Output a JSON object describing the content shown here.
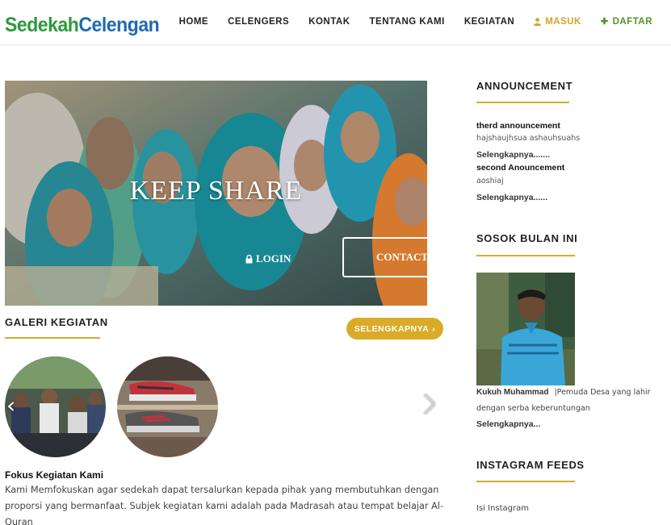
{
  "logo": {
    "part1": "Sedekah",
    "part2": "Celengan"
  },
  "nav": {
    "items": [
      "HOME",
      "CELENGERS",
      "KONTAK",
      "TENTANG KAMI",
      "KEGIATAN"
    ],
    "masuk": "MASUK",
    "daftar": "DAFTAR",
    "masuk_icon": "user-icon",
    "daftar_icon": "plus-icon"
  },
  "hero": {
    "title": "KEEP SHARE",
    "login_label": "LOGIN",
    "contact_label": "CONTACT"
  },
  "galeri": {
    "title": "GALERI KEGIATAN",
    "more_label": "SELENGKAPNYA"
  },
  "fokus": {
    "title": "Fokus Kegiatan Kami",
    "text": "Kami Memfokuskan agar sedekah dapat tersalurkan kepada pihak yang membutuhkan dengan proporsi yang bermanfaat. Subjek kegiatan kami adalah pada Madrasah atau tempat belajar Al-Quran"
  },
  "announcement": {
    "title": "ANNOUNCEMENT",
    "items": [
      {
        "title": "therd announcement",
        "body": "hajshaujhsua ashauhsuahs",
        "more": "Selengkapnya......."
      },
      {
        "title": "second Anouncement",
        "body": "aoshiaj",
        "more": "Selengkapnya......"
      }
    ]
  },
  "sosok": {
    "title": "SOSOK BULAN INI",
    "name": "Kukuh Muhammad",
    "desc_line1": "|Pemuda Desa yang lahir",
    "desc_line2": "dengan serba keberuntungan",
    "more": "Selengkapnya..."
  },
  "instagram": {
    "title": "INSTAGRAM FEEDS",
    "body": "Isi Instagram"
  },
  "colors": {
    "accent": "#d9ab28",
    "logo_green": "#2b9a3a",
    "logo_blue": "#1f6ab3",
    "daftar": "#5b8f2e"
  }
}
